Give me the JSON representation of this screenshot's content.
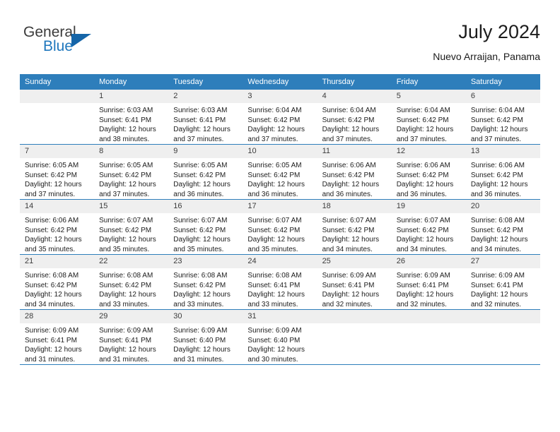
{
  "brand": {
    "word1": "General",
    "word2": "Blue",
    "logo_icon": "triangle-logo-icon",
    "color_blue": "#1f77bd",
    "color_triangle": "#1565a8"
  },
  "header": {
    "title": "July 2024",
    "subtitle": "Nuevo Arraijan, Panama"
  },
  "theme": {
    "header_bg": "#2e7ebb",
    "daynum_bg": "#efefef",
    "rule_color": "#2e7ebb",
    "text_color": "#1c1c1c"
  },
  "columns": [
    "Sunday",
    "Monday",
    "Tuesday",
    "Wednesday",
    "Thursday",
    "Friday",
    "Saturday"
  ],
  "weeks": [
    [
      {
        "day": "",
        "lines": []
      },
      {
        "day": "1",
        "lines": [
          "Sunrise: 6:03 AM",
          "Sunset: 6:41 PM",
          "Daylight: 12 hours",
          "and 38 minutes."
        ]
      },
      {
        "day": "2",
        "lines": [
          "Sunrise: 6:03 AM",
          "Sunset: 6:41 PM",
          "Daylight: 12 hours",
          "and 37 minutes."
        ]
      },
      {
        "day": "3",
        "lines": [
          "Sunrise: 6:04 AM",
          "Sunset: 6:42 PM",
          "Daylight: 12 hours",
          "and 37 minutes."
        ]
      },
      {
        "day": "4",
        "lines": [
          "Sunrise: 6:04 AM",
          "Sunset: 6:42 PM",
          "Daylight: 12 hours",
          "and 37 minutes."
        ]
      },
      {
        "day": "5",
        "lines": [
          "Sunrise: 6:04 AM",
          "Sunset: 6:42 PM",
          "Daylight: 12 hours",
          "and 37 minutes."
        ]
      },
      {
        "day": "6",
        "lines": [
          "Sunrise: 6:04 AM",
          "Sunset: 6:42 PM",
          "Daylight: 12 hours",
          "and 37 minutes."
        ]
      }
    ],
    [
      {
        "day": "7",
        "lines": [
          "Sunrise: 6:05 AM",
          "Sunset: 6:42 PM",
          "Daylight: 12 hours",
          "and 37 minutes."
        ]
      },
      {
        "day": "8",
        "lines": [
          "Sunrise: 6:05 AM",
          "Sunset: 6:42 PM",
          "Daylight: 12 hours",
          "and 37 minutes."
        ]
      },
      {
        "day": "9",
        "lines": [
          "Sunrise: 6:05 AM",
          "Sunset: 6:42 PM",
          "Daylight: 12 hours",
          "and 36 minutes."
        ]
      },
      {
        "day": "10",
        "lines": [
          "Sunrise: 6:05 AM",
          "Sunset: 6:42 PM",
          "Daylight: 12 hours",
          "and 36 minutes."
        ]
      },
      {
        "day": "11",
        "lines": [
          "Sunrise: 6:06 AM",
          "Sunset: 6:42 PM",
          "Daylight: 12 hours",
          "and 36 minutes."
        ]
      },
      {
        "day": "12",
        "lines": [
          "Sunrise: 6:06 AM",
          "Sunset: 6:42 PM",
          "Daylight: 12 hours",
          "and 36 minutes."
        ]
      },
      {
        "day": "13",
        "lines": [
          "Sunrise: 6:06 AM",
          "Sunset: 6:42 PM",
          "Daylight: 12 hours",
          "and 36 minutes."
        ]
      }
    ],
    [
      {
        "day": "14",
        "lines": [
          "Sunrise: 6:06 AM",
          "Sunset: 6:42 PM",
          "Daylight: 12 hours",
          "and 35 minutes."
        ]
      },
      {
        "day": "15",
        "lines": [
          "Sunrise: 6:07 AM",
          "Sunset: 6:42 PM",
          "Daylight: 12 hours",
          "and 35 minutes."
        ]
      },
      {
        "day": "16",
        "lines": [
          "Sunrise: 6:07 AM",
          "Sunset: 6:42 PM",
          "Daylight: 12 hours",
          "and 35 minutes."
        ]
      },
      {
        "day": "17",
        "lines": [
          "Sunrise: 6:07 AM",
          "Sunset: 6:42 PM",
          "Daylight: 12 hours",
          "and 35 minutes."
        ]
      },
      {
        "day": "18",
        "lines": [
          "Sunrise: 6:07 AM",
          "Sunset: 6:42 PM",
          "Daylight: 12 hours",
          "and 34 minutes."
        ]
      },
      {
        "day": "19",
        "lines": [
          "Sunrise: 6:07 AM",
          "Sunset: 6:42 PM",
          "Daylight: 12 hours",
          "and 34 minutes."
        ]
      },
      {
        "day": "20",
        "lines": [
          "Sunrise: 6:08 AM",
          "Sunset: 6:42 PM",
          "Daylight: 12 hours",
          "and 34 minutes."
        ]
      }
    ],
    [
      {
        "day": "21",
        "lines": [
          "Sunrise: 6:08 AM",
          "Sunset: 6:42 PM",
          "Daylight: 12 hours",
          "and 34 minutes."
        ]
      },
      {
        "day": "22",
        "lines": [
          "Sunrise: 6:08 AM",
          "Sunset: 6:42 PM",
          "Daylight: 12 hours",
          "and 33 minutes."
        ]
      },
      {
        "day": "23",
        "lines": [
          "Sunrise: 6:08 AM",
          "Sunset: 6:42 PM",
          "Daylight: 12 hours",
          "and 33 minutes."
        ]
      },
      {
        "day": "24",
        "lines": [
          "Sunrise: 6:08 AM",
          "Sunset: 6:41 PM",
          "Daylight: 12 hours",
          "and 33 minutes."
        ]
      },
      {
        "day": "25",
        "lines": [
          "Sunrise: 6:09 AM",
          "Sunset: 6:41 PM",
          "Daylight: 12 hours",
          "and 32 minutes."
        ]
      },
      {
        "day": "26",
        "lines": [
          "Sunrise: 6:09 AM",
          "Sunset: 6:41 PM",
          "Daylight: 12 hours",
          "and 32 minutes."
        ]
      },
      {
        "day": "27",
        "lines": [
          "Sunrise: 6:09 AM",
          "Sunset: 6:41 PM",
          "Daylight: 12 hours",
          "and 32 minutes."
        ]
      }
    ],
    [
      {
        "day": "28",
        "lines": [
          "Sunrise: 6:09 AM",
          "Sunset: 6:41 PM",
          "Daylight: 12 hours",
          "and 31 minutes."
        ]
      },
      {
        "day": "29",
        "lines": [
          "Sunrise: 6:09 AM",
          "Sunset: 6:41 PM",
          "Daylight: 12 hours",
          "and 31 minutes."
        ]
      },
      {
        "day": "30",
        "lines": [
          "Sunrise: 6:09 AM",
          "Sunset: 6:40 PM",
          "Daylight: 12 hours",
          "and 31 minutes."
        ]
      },
      {
        "day": "31",
        "lines": [
          "Sunrise: 6:09 AM",
          "Sunset: 6:40 PM",
          "Daylight: 12 hours",
          "and 30 minutes."
        ]
      },
      {
        "day": "",
        "lines": []
      },
      {
        "day": "",
        "lines": []
      },
      {
        "day": "",
        "lines": []
      }
    ]
  ]
}
